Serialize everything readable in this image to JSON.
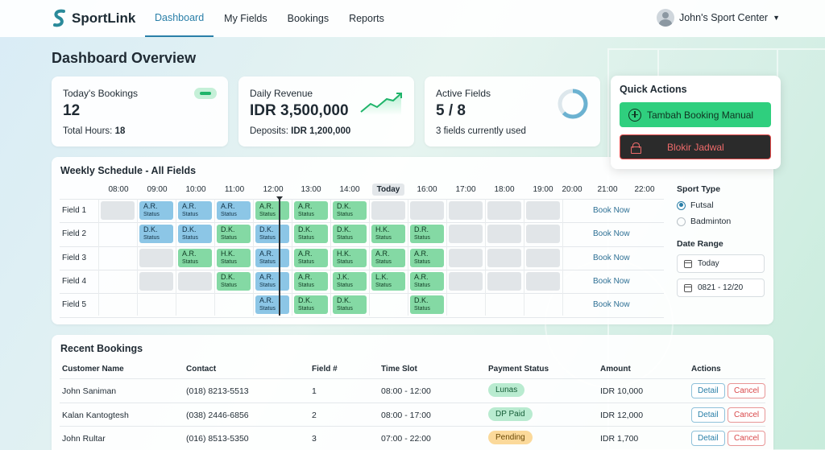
{
  "nav": {
    "brand": "SportLink",
    "tabs": [
      "Dashboard",
      "My Fields",
      "Bookings",
      "Reports"
    ],
    "active_tab": "Dashboard",
    "user": "John's Sport Center"
  },
  "page_title": "Dashboard Overview",
  "stats": {
    "bookings": {
      "label": "Today's Bookings",
      "value": "12",
      "sub_label": "Total Hours: ",
      "sub_value": "18"
    },
    "revenue": {
      "label": "Daily Revenue",
      "value": "IDR 3,500,000",
      "sub_label": "Deposits: ",
      "sub_value": "IDR 1,200,000"
    },
    "fields": {
      "label": "Active Fields",
      "value": "5 / 8",
      "sub": "3 fields currently used",
      "usage_fraction": 0.625
    }
  },
  "quick_actions": {
    "title": "Quick Actions",
    "add_label": "Tambah Booking Manual",
    "block_label": "Blokir Jadwal"
  },
  "schedule": {
    "title": "Weekly Schedule - All Fields",
    "times": [
      "08:00",
      "09:00",
      "10:00",
      "11:00",
      "12:00",
      "13:00",
      "14:00",
      "Today",
      "16:00",
      "17:00",
      "18:00",
      "19:00",
      "20:00",
      "21:00",
      "22:00"
    ],
    "book_now": "Book Now",
    "status_word": "Status",
    "fields": [
      {
        "name": "Field 1",
        "slots": [
          [
            "e",
            ""
          ],
          [
            "b",
            "A.R."
          ],
          [
            "b",
            "A.R."
          ],
          [
            "b",
            "A.R."
          ],
          [
            "g",
            "A.R."
          ],
          [
            "g",
            "A.R."
          ],
          [
            "g",
            "D.K."
          ],
          [
            "e",
            ""
          ],
          [
            "e",
            ""
          ],
          [
            "e",
            ""
          ],
          [
            "e",
            ""
          ],
          [
            "e",
            ""
          ]
        ]
      },
      {
        "name": "Field 2",
        "slots": [
          [
            "n",
            ""
          ],
          [
            "b",
            "D.K."
          ],
          [
            "b",
            "D.K."
          ],
          [
            "g",
            "D.K."
          ],
          [
            "b",
            "D.K."
          ],
          [
            "g",
            "D.K."
          ],
          [
            "g",
            "D.K."
          ],
          [
            "g",
            "H.K."
          ],
          [
            "g",
            "D.R."
          ],
          [
            "e",
            ""
          ],
          [
            "e",
            ""
          ],
          [
            "e",
            ""
          ]
        ]
      },
      {
        "name": "Field 3",
        "slots": [
          [
            "n",
            ""
          ],
          [
            "e",
            ""
          ],
          [
            "g",
            "A.R."
          ],
          [
            "g",
            "H.K."
          ],
          [
            "b",
            "A.R."
          ],
          [
            "g",
            "A.R."
          ],
          [
            "g",
            "H.K."
          ],
          [
            "g",
            "A.R."
          ],
          [
            "g",
            "A.R."
          ],
          [
            "e",
            ""
          ],
          [
            "e",
            ""
          ],
          [
            "e",
            ""
          ]
        ]
      },
      {
        "name": "Field 4",
        "slots": [
          [
            "n",
            ""
          ],
          [
            "e",
            ""
          ],
          [
            "e",
            ""
          ],
          [
            "g",
            "D.K."
          ],
          [
            "b",
            "A.R."
          ],
          [
            "g",
            "A.R."
          ],
          [
            "g",
            "J.K."
          ],
          [
            "g",
            "L.K."
          ],
          [
            "g",
            "A.R."
          ],
          [
            "e",
            ""
          ],
          [
            "e",
            ""
          ],
          [
            "e",
            ""
          ]
        ]
      },
      {
        "name": "Field 5",
        "slots": [
          [
            "n",
            ""
          ],
          [
            "n",
            ""
          ],
          [
            "n",
            ""
          ],
          [
            "n",
            ""
          ],
          [
            "b",
            "A.R."
          ],
          [
            "g",
            "D.K."
          ],
          [
            "g",
            "D.K."
          ],
          [
            "n",
            ""
          ],
          [
            "g",
            "D.K."
          ],
          [
            "n",
            ""
          ],
          [
            "n",
            ""
          ],
          [
            "n",
            ""
          ]
        ]
      }
    ],
    "filters": {
      "sport_title": "Sport Type",
      "sports": [
        "Futsal",
        "Badminton"
      ],
      "selected_sport": "Futsal",
      "date_title": "Date Range",
      "date1": "Today",
      "date2": "0821 - 12/20"
    }
  },
  "recent": {
    "title": "Recent Bookings",
    "headers": [
      "Customer Name",
      "Contact",
      "Field #",
      "Time Slot",
      "Payment Status",
      "Amount",
      "Actions"
    ],
    "detail_label": "Detail",
    "cancel_label": "Cancel",
    "rows": [
      {
        "name": "John Saniman",
        "contact": "(018) 8213-5513",
        "field": "1",
        "time": "08:00 - 12:00",
        "status": "Lunas",
        "status_color": "green",
        "amount": "IDR 10,000"
      },
      {
        "name": "Kalan Kantogtesh",
        "contact": "(038) 2446-6856",
        "field": "2",
        "time": "08:00 - 17:00",
        "status": "DP Paid",
        "status_color": "green",
        "amount": "IDR 12,000"
      },
      {
        "name": "John Rultar",
        "contact": "(016) 8513-5350",
        "field": "3",
        "time": "07:00 - 22:00",
        "status": "Pending",
        "status_color": "amber",
        "amount": "IDR 1,700"
      }
    ]
  },
  "colors": {
    "accent": "#2a7fa8",
    "green": "#2fcf7e",
    "danger": "#e54a4a"
  }
}
